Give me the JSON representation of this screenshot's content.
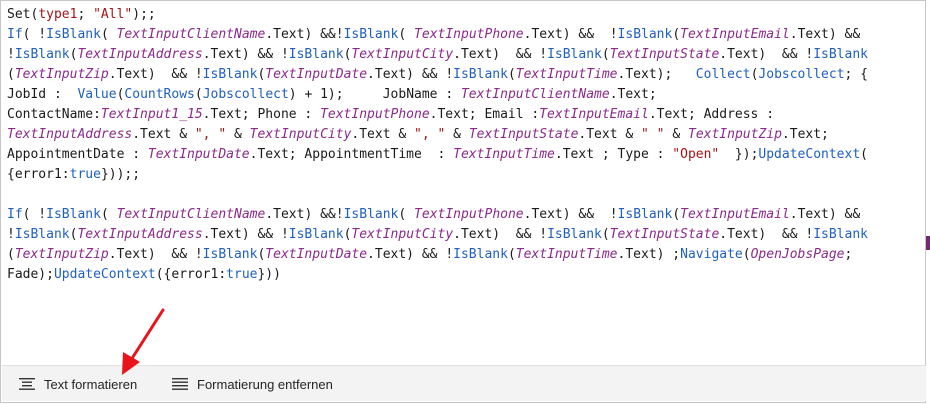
{
  "code": {
    "lines": [
      [
        [
          "t",
          "Set("
        ],
        [
          "s",
          "type1"
        ],
        [
          "t",
          "; "
        ],
        [
          "s",
          "\"All\""
        ],
        [
          "t",
          ");;"
        ]
      ],
      [
        [
          "f",
          "If"
        ],
        [
          "t",
          "( !"
        ],
        [
          "f",
          "IsBlank"
        ],
        [
          "t",
          "( "
        ],
        [
          "v",
          "TextInputClientName"
        ],
        [
          "t",
          ".Text) &&!"
        ],
        [
          "f",
          "IsBlank"
        ],
        [
          "t",
          "( "
        ],
        [
          "v",
          "TextInputPhone"
        ],
        [
          "t",
          ".Text) &&  !"
        ],
        [
          "f",
          "IsBlank"
        ],
        [
          "t",
          "("
        ],
        [
          "v",
          "TextInputEmail"
        ],
        [
          "t",
          ".Text) &&"
        ]
      ],
      [
        [
          "t",
          "!"
        ],
        [
          "f",
          "IsBlank"
        ],
        [
          "t",
          "("
        ],
        [
          "v",
          "TextInputAddress"
        ],
        [
          "t",
          ".Text) && !"
        ],
        [
          "f",
          "IsBlank"
        ],
        [
          "t",
          "("
        ],
        [
          "v",
          "TextInputCity"
        ],
        [
          "t",
          ".Text)  && !"
        ],
        [
          "f",
          "IsBlank"
        ],
        [
          "t",
          "("
        ],
        [
          "v",
          "TextInputState"
        ],
        [
          "t",
          ".Text)  && !"
        ],
        [
          "f",
          "IsBlank"
        ]
      ],
      [
        [
          "t",
          "("
        ],
        [
          "v",
          "TextInputZip"
        ],
        [
          "t",
          ".Text)  && !"
        ],
        [
          "f",
          "IsBlank"
        ],
        [
          "t",
          "("
        ],
        [
          "v",
          "TextInputDate"
        ],
        [
          "t",
          ".Text) && !"
        ],
        [
          "f",
          "IsBlank"
        ],
        [
          "t",
          "("
        ],
        [
          "v",
          "TextInputTime"
        ],
        [
          "t",
          ".Text);   "
        ],
        [
          "f",
          "Collect"
        ],
        [
          "t",
          "("
        ],
        [
          "f",
          "Jobscollect"
        ],
        [
          "t",
          "; {"
        ]
      ],
      [
        [
          "t",
          "JobId :  "
        ],
        [
          "f",
          "Value"
        ],
        [
          "t",
          "("
        ],
        [
          "f",
          "CountRows"
        ],
        [
          "t",
          "("
        ],
        [
          "f",
          "Jobscollect"
        ],
        [
          "t",
          ") + 1);     JobName : "
        ],
        [
          "v",
          "TextInputClientName"
        ],
        [
          "t",
          ".Text;"
        ]
      ],
      [
        [
          "t",
          "ContactName:"
        ],
        [
          "v",
          "TextInput1_15"
        ],
        [
          "t",
          ".Text; Phone : "
        ],
        [
          "v",
          "TextInputPhone"
        ],
        [
          "t",
          ".Text; Email :"
        ],
        [
          "v",
          "TextInputEmail"
        ],
        [
          "t",
          ".Text; Address :"
        ]
      ],
      [
        [
          "v",
          "TextInputAddress"
        ],
        [
          "t",
          ".Text & "
        ],
        [
          "s",
          "\", \""
        ],
        [
          "t",
          " & "
        ],
        [
          "v",
          "TextInputCity"
        ],
        [
          "t",
          ".Text & "
        ],
        [
          "s",
          "\", \""
        ],
        [
          "t",
          " & "
        ],
        [
          "v",
          "TextInputState"
        ],
        [
          "t",
          ".Text & "
        ],
        [
          "s",
          "\" \""
        ],
        [
          "t",
          " & "
        ],
        [
          "v",
          "TextInputZip"
        ],
        [
          "t",
          ".Text;"
        ]
      ],
      [
        [
          "t",
          "AppointmentDate : "
        ],
        [
          "v",
          "TextInputDate"
        ],
        [
          "t",
          ".Text; AppointmentTime  : "
        ],
        [
          "v",
          "TextInputTime"
        ],
        [
          "t",
          ".Text ; Type : "
        ],
        [
          "s",
          "\"Open\""
        ],
        [
          "t",
          "  });"
        ],
        [
          "f",
          "UpdateContext"
        ],
        [
          "t",
          "("
        ]
      ],
      [
        [
          "t",
          "{error1:"
        ],
        [
          "f",
          "true"
        ],
        [
          "t",
          "}));;"
        ]
      ],
      [],
      [
        [
          "f",
          "If"
        ],
        [
          "t",
          "( !"
        ],
        [
          "f",
          "IsBlank"
        ],
        [
          "t",
          "( "
        ],
        [
          "v",
          "TextInputClientName"
        ],
        [
          "t",
          ".Text) &&!"
        ],
        [
          "f",
          "IsBlank"
        ],
        [
          "t",
          "( "
        ],
        [
          "v",
          "TextInputPhone"
        ],
        [
          "t",
          ".Text) &&  !"
        ],
        [
          "f",
          "IsBlank"
        ],
        [
          "t",
          "("
        ],
        [
          "v",
          "TextInputEmail"
        ],
        [
          "t",
          ".Text) &&"
        ]
      ],
      [
        [
          "t",
          "!"
        ],
        [
          "f",
          "IsBlank"
        ],
        [
          "t",
          "("
        ],
        [
          "v",
          "TextInputAddress"
        ],
        [
          "t",
          ".Text) && !"
        ],
        [
          "f",
          "IsBlank"
        ],
        [
          "t",
          "("
        ],
        [
          "v",
          "TextInputCity"
        ],
        [
          "t",
          ".Text)  && !"
        ],
        [
          "f",
          "IsBlank"
        ],
        [
          "t",
          "("
        ],
        [
          "v",
          "TextInputState"
        ],
        [
          "t",
          ".Text)  && !"
        ],
        [
          "f",
          "IsBlank"
        ]
      ],
      [
        [
          "t",
          "("
        ],
        [
          "v",
          "TextInputZip"
        ],
        [
          "t",
          ".Text)  && !"
        ],
        [
          "f",
          "IsBlank"
        ],
        [
          "t",
          "("
        ],
        [
          "v",
          "TextInputDate"
        ],
        [
          "t",
          ".Text) && !"
        ],
        [
          "f",
          "IsBlank"
        ],
        [
          "t",
          "("
        ],
        [
          "v",
          "TextInputTime"
        ],
        [
          "t",
          ".Text) ;"
        ],
        [
          "f",
          "Navigate"
        ],
        [
          "t",
          "("
        ],
        [
          "v",
          "OpenJobsPage"
        ],
        [
          "t",
          ";"
        ]
      ],
      [
        [
          "t",
          "Fade);"
        ],
        [
          "f",
          "UpdateContext"
        ],
        [
          "t",
          "({error1:"
        ],
        [
          "f",
          "true"
        ],
        [
          "t",
          "}))"
        ]
      ]
    ]
  },
  "toolbar": {
    "format_text_label": "Text formatieren",
    "remove_formatting_label": "Formatierung entfernen"
  },
  "colors": {
    "function": "#1f5fbf",
    "control": "#8a2a8a",
    "string": "#a31515",
    "annotation_arrow": "#e8141a"
  }
}
